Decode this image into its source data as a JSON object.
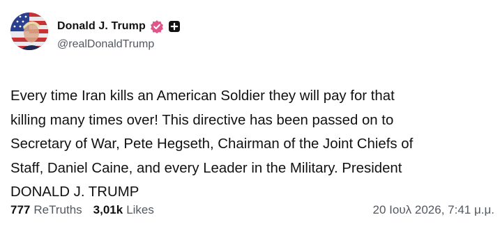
{
  "author": {
    "display_name": "Donald J. Trump",
    "handle": "@realDonaldTrump",
    "verified_color": "#e0558a",
    "avatar": "profile-photo"
  },
  "post": {
    "text": "Every time Iran kills an American Soldier they will pay for that\nkilling many times over! This directive has been passed on to\nSecretary of War, Pete Hegseth, Chairman of the Joint Chiefs of\nStaff, Daniel Caine, and every Leader in the Military. President\nDONALD J. TRUMP"
  },
  "stats": {
    "retruths_count": "777",
    "retruths_label": "ReTruths",
    "likes_count": "3,01k",
    "likes_label": "Likes"
  },
  "timestamp": "20 Ιουλ 2026, 7:41 μ.μ.",
  "icons": {
    "verified": "verified-badge-icon",
    "plus": "plus-badge-icon"
  }
}
